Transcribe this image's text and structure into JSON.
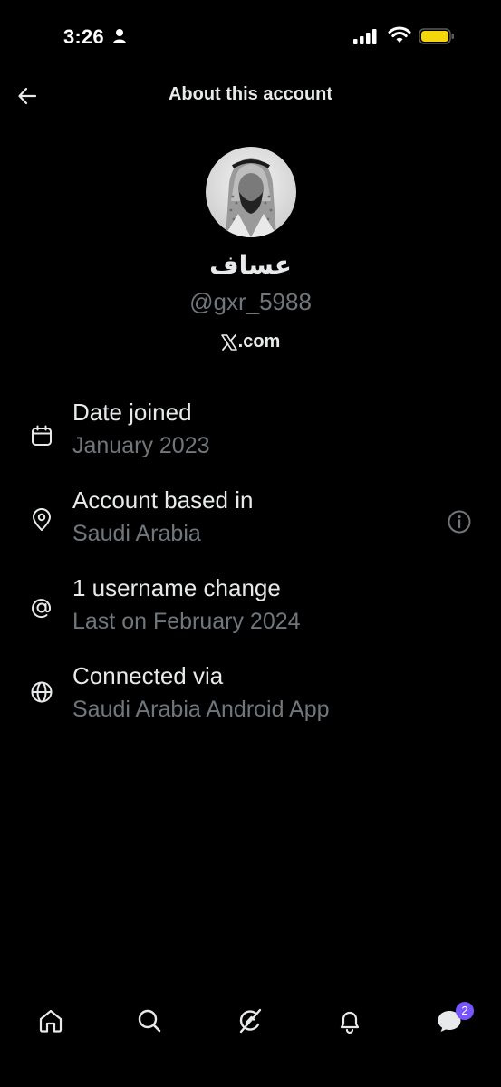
{
  "status_bar": {
    "time": "3:26"
  },
  "header": {
    "title": "About this account"
  },
  "profile": {
    "display_name": "عساف",
    "handle": "@gxr_5988",
    "site": ".com"
  },
  "info_rows": [
    {
      "icon": "calendar-icon",
      "title": "Date joined",
      "subtitle": "January 2023"
    },
    {
      "icon": "location-pin-icon",
      "title": "Account based in",
      "subtitle": "Saudi Arabia"
    },
    {
      "icon": "at-sign-icon",
      "title": "1 username change",
      "subtitle": "Last on February 2024"
    },
    {
      "icon": "globe-icon",
      "title": "Connected via",
      "subtitle": "Saudi Arabia Android App"
    }
  ],
  "bottom_nav": {
    "items": [
      "home-icon",
      "search-icon",
      "grok-icon",
      "notifications-bell-icon",
      "messages-icon"
    ],
    "messages_badge": "2"
  },
  "colors": {
    "background": "#000000",
    "primary_text": "#e7e9ea",
    "secondary_text": "#71767b",
    "badge": "#7856ff",
    "battery": "#f5d60a"
  }
}
